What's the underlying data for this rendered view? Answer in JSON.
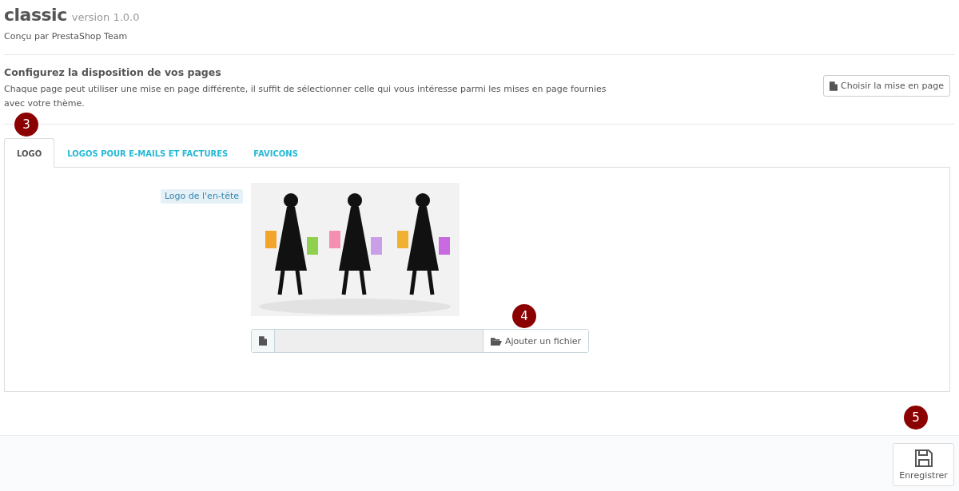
{
  "theme": {
    "name": "classic",
    "version": "version 1.0.0",
    "author": "Conçu par PrestaShop Team"
  },
  "layout": {
    "title": "Configurez la disposition de vos pages",
    "description": "Chaque page peut utiliser une mise en page différente, il suffit de sélectionner celle qui vous intéresse parmi les mises en page fournies avec votre thème.",
    "button": "Choisir la mise en page"
  },
  "tabs": [
    {
      "label": "LOGO",
      "selected": true
    },
    {
      "label": "LOGOS POUR E-MAILS ET FACTURES",
      "selected": false
    },
    {
      "label": "FAVICONS",
      "selected": false
    }
  ],
  "logo_field": {
    "label": "Logo de l'en-tête",
    "upload_button": "Ajouter un fichier"
  },
  "save_button": "Enregistrer",
  "callouts": [
    "3",
    "4",
    "5"
  ]
}
